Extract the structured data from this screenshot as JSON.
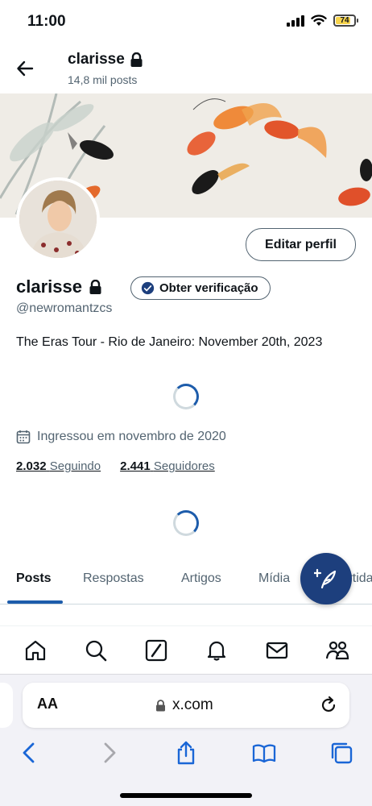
{
  "status_bar": {
    "time": "11:00",
    "battery": "74"
  },
  "header": {
    "name": "clarisse",
    "posts": "14,8 mil posts"
  },
  "profile": {
    "edit_label": "Editar perfil",
    "name": "clarisse",
    "verify_label": "Obter verificação",
    "handle": "@newromantzcs",
    "bio": "The Eras Tour - Rio de Janeiro: November 20th, 2023",
    "joined": "Ingressou em novembro de 2020",
    "following_count": "2.032",
    "following_label": "Seguindo",
    "followers_count": "2.441",
    "followers_label": "Seguidores"
  },
  "tabs": [
    "Posts",
    "Respostas",
    "Artigos",
    "Mídia",
    "Curtidas"
  ],
  "bottom_nav": [
    "home-icon",
    "search-icon",
    "grok-icon",
    "notifications-icon",
    "messages-icon",
    "communities-icon"
  ],
  "browser": {
    "text_size_label": "AA",
    "url": "x.com"
  },
  "colors": {
    "accent": "#1d5cab",
    "fab": "#1d3f7d",
    "muted": "#536471"
  }
}
